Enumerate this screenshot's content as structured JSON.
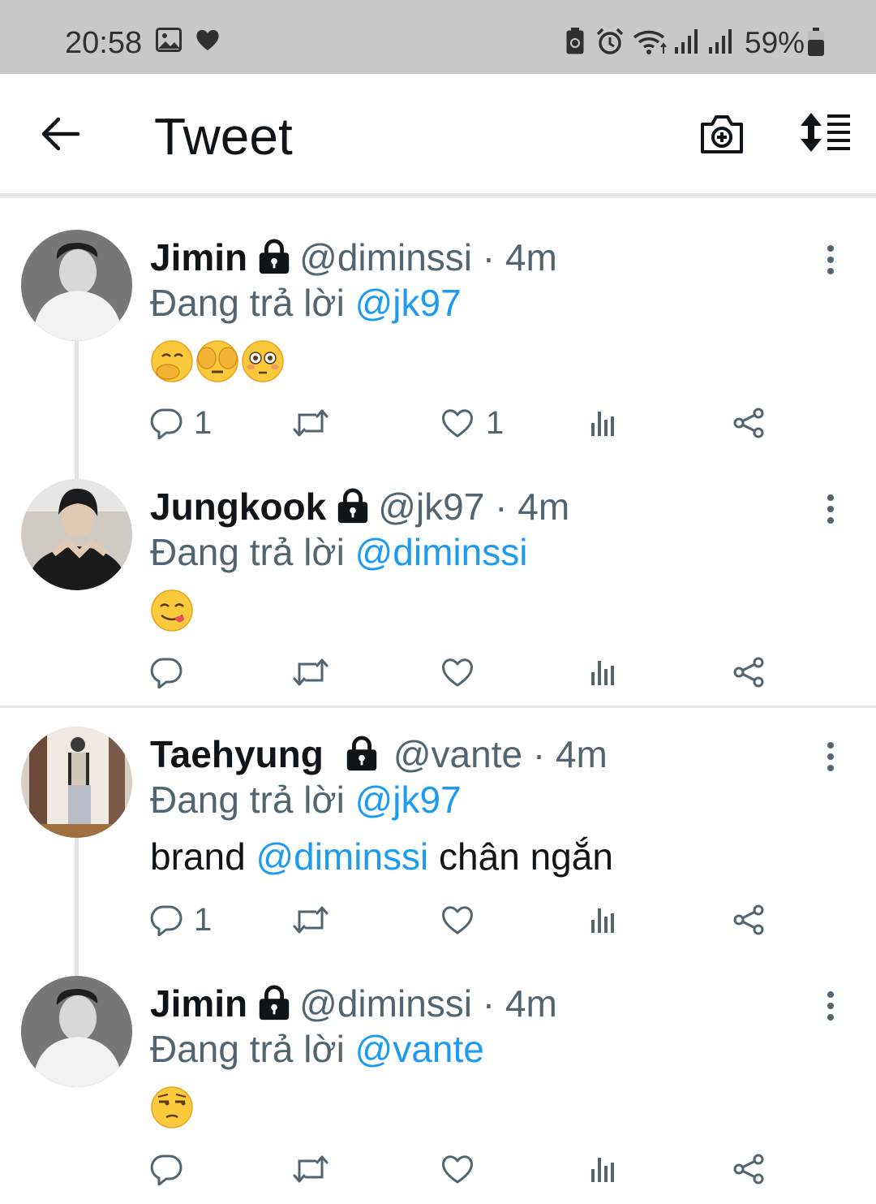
{
  "status_bar": {
    "time": "20:58",
    "battery": "59%",
    "icons": [
      "image-icon",
      "heart-icon",
      "battery-saver-icon",
      "alarm-icon",
      "wifi-icon",
      "signal-icon",
      "signal-icon",
      "battery-icon"
    ]
  },
  "header": {
    "title": "Tweet",
    "back_icon": "arrow-left-icon",
    "camera_icon": "camera-add-icon",
    "sort_icon": "sort-icon"
  },
  "colors": {
    "accent": "#1d9bf0",
    "muted": "#536471",
    "text": "#0f1419"
  },
  "tweets": [
    {
      "name": "Jimin",
      "handle": "@diminssi",
      "dot": "·",
      "time": "4m",
      "reply_prefix": "Đang trả lời ",
      "reply_to": "@jk97",
      "emojis": [
        "hand-over-mouth-emoji",
        "see-no-evil-emoji",
        "flushed-emoji"
      ],
      "reply_count": "1",
      "retweet_count": "",
      "like_count": "1"
    },
    {
      "name": "Jungkook",
      "handle": "@jk97",
      "dot": "·",
      "time": "4m",
      "reply_prefix": "Đang trả lời ",
      "reply_to": "@diminssi",
      "emojis": [
        "yum-emoji"
      ],
      "reply_count": "",
      "retweet_count": "",
      "like_count": ""
    },
    {
      "name": "Taehyung",
      "handle": "@vante",
      "dot": "·",
      "time": "4m",
      "reply_prefix": "Đang trả lời ",
      "reply_to": "@jk97",
      "text_before": "brand ",
      "text_mention": "@diminssi",
      "text_after": " chân ngắn",
      "reply_count": "1",
      "retweet_count": "",
      "like_count": ""
    },
    {
      "name": "Jimin",
      "handle": "@diminssi",
      "dot": "·",
      "time": "4m",
      "reply_prefix": "Đang trả lời ",
      "reply_to": "@vante",
      "emojis": [
        "unamused-emoji"
      ],
      "reply_count": "",
      "retweet_count": "",
      "like_count": ""
    }
  ]
}
